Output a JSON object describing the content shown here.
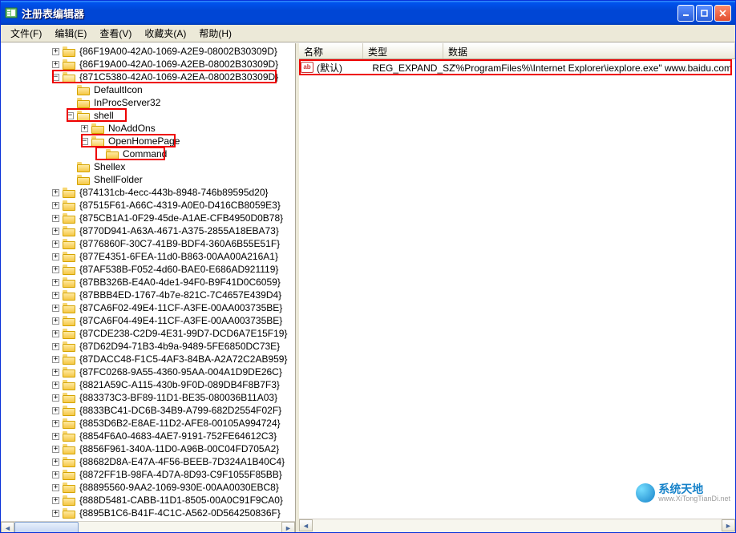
{
  "window": {
    "title": "注册表编辑器"
  },
  "menu": {
    "file": "文件(F)",
    "edit": "编辑(E)",
    "view": "查看(V)",
    "favorites": "收藏夹(A)",
    "help": "帮助(H)"
  },
  "list": {
    "headers": {
      "name": "名称",
      "type": "类型",
      "data": "数据"
    },
    "rows": [
      {
        "name": "(默认)",
        "type": "REG_EXPAND_SZ",
        "data": "\"%ProgramFiles%\\Internet Explorer\\iexplore.exe\" www.baidu.com"
      }
    ]
  },
  "tree": [
    {
      "depth": 0,
      "exp": "+",
      "label": "{86F19A00-42A0-1069-A2E9-08002B30309D}"
    },
    {
      "depth": 0,
      "exp": "+",
      "label": "{86F19A00-42A0-1069-A2EB-08002B30309D}"
    },
    {
      "depth": 0,
      "exp": "-",
      "label": "{871C5380-42A0-1069-A2EA-08002B30309D}",
      "hl": true,
      "open": true
    },
    {
      "depth": 1,
      "exp": "",
      "label": "DefaultIcon"
    },
    {
      "depth": 1,
      "exp": "",
      "label": "InProcServer32"
    },
    {
      "depth": 1,
      "exp": "-",
      "label": "shell",
      "hl": true,
      "open": true
    },
    {
      "depth": 2,
      "exp": "+",
      "label": "NoAddOns"
    },
    {
      "depth": 2,
      "exp": "-",
      "label": "OpenHomePage",
      "hl": true,
      "open": true
    },
    {
      "depth": 3,
      "exp": "",
      "label": "Command",
      "hl": true
    },
    {
      "depth": 1,
      "exp": "",
      "label": "Shellex"
    },
    {
      "depth": 1,
      "exp": "",
      "label": "ShellFolder"
    },
    {
      "depth": 0,
      "exp": "+",
      "label": "{874131cb-4ecc-443b-8948-746b89595d20}"
    },
    {
      "depth": 0,
      "exp": "+",
      "label": "{87515F61-A66C-4319-A0E0-D416CB8059E3}"
    },
    {
      "depth": 0,
      "exp": "+",
      "label": "{875CB1A1-0F29-45de-A1AE-CFB4950D0B78}"
    },
    {
      "depth": 0,
      "exp": "+",
      "label": "{8770D941-A63A-4671-A375-2855A18EBA73}"
    },
    {
      "depth": 0,
      "exp": "+",
      "label": "{8776860F-30C7-41B9-BDF4-360A6B55E51F}"
    },
    {
      "depth": 0,
      "exp": "+",
      "label": "{877E4351-6FEA-11d0-B863-00AA00A216A1}"
    },
    {
      "depth": 0,
      "exp": "+",
      "label": "{87AF538B-F052-4d60-BAE0-E686AD921119}"
    },
    {
      "depth": 0,
      "exp": "+",
      "label": "{87BB326B-E4A0-4de1-94F0-B9F41D0C6059}"
    },
    {
      "depth": 0,
      "exp": "+",
      "label": "{87BBB4ED-1767-4b7e-821C-7C4657E439D4}"
    },
    {
      "depth": 0,
      "exp": "+",
      "label": "{87CA6F02-49E4-11CF-A3FE-00AA003735BE}"
    },
    {
      "depth": 0,
      "exp": "+",
      "label": "{87CA6F04-49E4-11CF-A3FE-00AA003735BE}"
    },
    {
      "depth": 0,
      "exp": "+",
      "label": "{87CDE238-C2D9-4E31-99D7-DCD6A7E15F19}"
    },
    {
      "depth": 0,
      "exp": "+",
      "label": "{87D62D94-71B3-4b9a-9489-5FE6850DC73E}"
    },
    {
      "depth": 0,
      "exp": "+",
      "label": "{87DACC48-F1C5-4AF3-84BA-A2A72C2AB959}"
    },
    {
      "depth": 0,
      "exp": "+",
      "label": "{87FC0268-9A55-4360-95AA-004A1D9DE26C}"
    },
    {
      "depth": 0,
      "exp": "+",
      "label": "{8821A59C-A115-430b-9F0D-089DB4F8B7F3}"
    },
    {
      "depth": 0,
      "exp": "+",
      "label": "{883373C3-BF89-11D1-BE35-080036B11A03}"
    },
    {
      "depth": 0,
      "exp": "+",
      "label": "{8833BC41-DC6B-34B9-A799-682D2554F02F}"
    },
    {
      "depth": 0,
      "exp": "+",
      "label": "{8853D6B2-E8AE-11D2-AFE8-00105A994724}"
    },
    {
      "depth": 0,
      "exp": "+",
      "label": "{8854F6A0-4683-4AE7-9191-752FE64612C3}"
    },
    {
      "depth": 0,
      "exp": "+",
      "label": "{8856F961-340A-11D0-A96B-00C04FD705A2}"
    },
    {
      "depth": 0,
      "exp": "+",
      "label": "{88682D8A-E47A-4F56-BEEB-7D324A1B40C4}"
    },
    {
      "depth": 0,
      "exp": "+",
      "label": "{8872FF1B-98FA-4D7A-8D93-C9F1055F85BB}"
    },
    {
      "depth": 0,
      "exp": "+",
      "label": "{88895560-9AA2-1069-930E-00AA0030EBC8}"
    },
    {
      "depth": 0,
      "exp": "+",
      "label": "{888D5481-CABB-11D1-8505-00A0C91F9CA0}"
    },
    {
      "depth": 0,
      "exp": "+",
      "label": "{8895B1C6-B41F-4C1C-A562-0D564250836F}"
    }
  ],
  "watermark": {
    "text": "系统天地",
    "url": "www.XiTongTianDi.net"
  }
}
